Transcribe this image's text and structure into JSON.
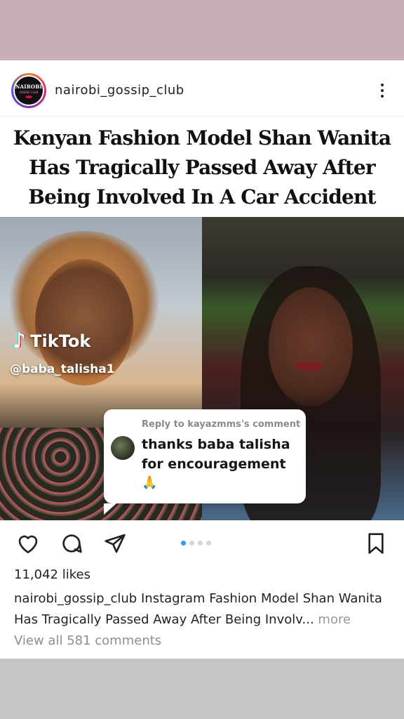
{
  "post": {
    "username": "nairobi_gossip_club",
    "avatar": {
      "line1": "NAIROBI",
      "line2": "GOSSIP CLUB"
    },
    "headline": [
      "Kenyan Fashion Model Shan Wanita",
      "Has Tragically Passed Away After",
      "Being Involved In A Car Accident"
    ],
    "likes": "11,042 likes",
    "caption_user": "nairobi_gossip_club",
    "caption_line1": "Instagram Fashion Model Shan Wanita",
    "caption_line2": "Has Tragically Passed Away After Being Involv...",
    "caption_more": "more",
    "view_comments": "View all 581 comments",
    "carousel_active_index": 0,
    "carousel_count": 4
  },
  "overlay": {
    "tiktok_label": "TikTok",
    "tiktok_handle": "@baba_talisha1",
    "reply_header": "Reply to kayazmms's comment",
    "reply_text": "thanks baba talisha for encouragement",
    "reply_emoji": "🙏"
  },
  "icons": [
    "heart-icon",
    "comment-icon",
    "share-icon",
    "bookmark-icon",
    "more-options-icon"
  ],
  "colors": {
    "accent_blue": "#3897f0",
    "background_top": "#c8aeb9",
    "background_bottom": "#c5c5c5"
  }
}
